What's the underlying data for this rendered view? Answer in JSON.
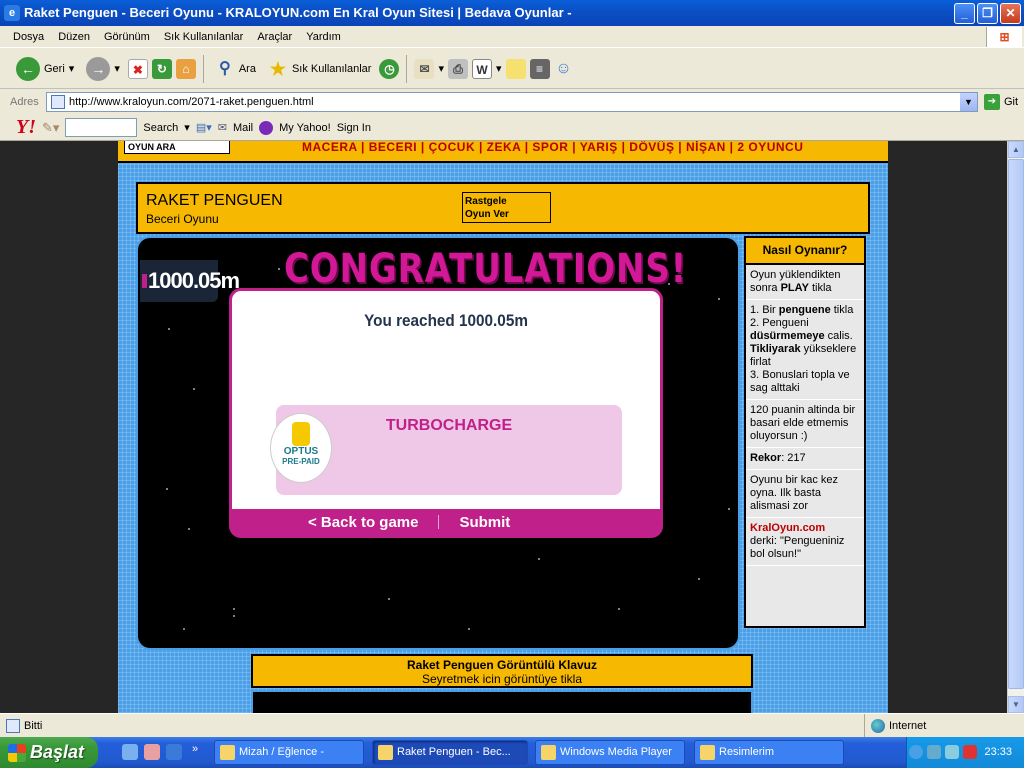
{
  "window": {
    "title": "Raket Penguen - Beceri Oyunu - KRALOYUN.com En Kral Oyun Sitesi | Bedava Oyunlar -"
  },
  "menu": [
    "Dosya",
    "Düzen",
    "Görünüm",
    "Sık Kullanılanlar",
    "Araçlar",
    "Yardım"
  ],
  "toolbar": {
    "back": "Geri",
    "search": "Ara",
    "favorites": "Sık Kullanılanlar"
  },
  "address": {
    "label": "Adres",
    "url": "http://www.kraloyun.com/2071-raket.penguen.html",
    "go": "Git"
  },
  "yahoo": {
    "search": "Search",
    "mail": "Mail",
    "myyahoo": "My Yahoo!",
    "signin": "Sign In"
  },
  "site": {
    "nav_search": "OYUN ARA",
    "categories": "MACERA | BECERI | ÇOCUK | ZEKA | SPOR | YARIŞ | DÖVÜŞ | NİŞAN | 2 OYUNCU",
    "game_title": "RAKET PENGUEN",
    "game_subtitle": "Beceri Oyunu",
    "random_line1": "Rastgele",
    "random_line2": "Oyun Ver"
  },
  "game": {
    "score": "1000.05m",
    "congrats": "CONGRATULATIONS!",
    "reached": "You reached 1000.05m",
    "turbo": "TURBOCHARGE",
    "optus": "OPTUS",
    "prepaid": "PRE-PAID",
    "back": "< Back to game",
    "submit": "Submit"
  },
  "sidebar": {
    "header": "Nasıl Oynanır?",
    "b1_a": "Oyun yüklendikten sonra ",
    "b1_b": "PLAY",
    "b1_c": " tikla",
    "b2_1a": "1. Bir ",
    "b2_1b": "penguene",
    "b2_1c": " tikla",
    "b2_2a": "2. Pengueni ",
    "b2_2b": "düsürmemeye",
    "b2_2c": " calis. ",
    "b2_2d": "Tikliyarak",
    "b2_2e": " yükseklere firlat",
    "b2_3": "3. Bonuslari topla ve sag alttaki",
    "b3": "120 puanin altinda bir basari elde etmemis oluyorsun :)",
    "record_label": "Rekor",
    "record_value": ": 217",
    "b5": "Oyunu bir kac kez oyna. Ilk basta alismasi zor",
    "site_name": "KralOyun.com",
    "quote": "derki: \"Pengueniniz bol olsun!\""
  },
  "video": {
    "title": "Raket Penguen Görüntülü Klavuz",
    "sub": "Seyretmek icin görüntüye tikla"
  },
  "status": {
    "text": "Bitti",
    "zone": "Internet"
  },
  "taskbar": {
    "start": "Başlat",
    "tasks": [
      "Mizah / Eğlence -",
      "Raket Penguen - Bec...",
      "Windows Media Player",
      "Resimlerim"
    ],
    "clock": "23:33"
  }
}
